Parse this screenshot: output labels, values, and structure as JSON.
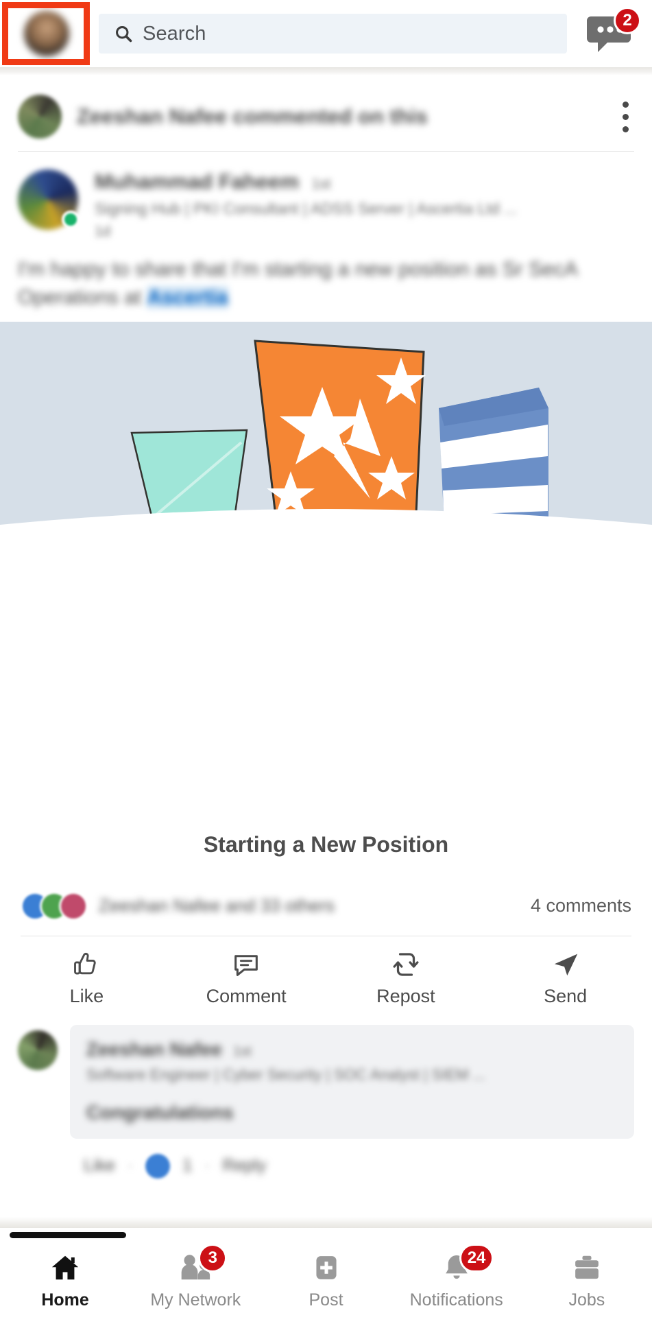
{
  "header": {
    "avatar_name": "profile-avatar",
    "search": {
      "placeholder": "Search",
      "icon": "search-icon"
    },
    "messaging": {
      "icon": "messaging-icon",
      "badge": "2"
    },
    "highlight_color": "#f03a15"
  },
  "post": {
    "context_text": "Zeeshan Nafee commented on this",
    "menu_icon": "more-options-icon",
    "author": {
      "name": "Muhammad Faheem",
      "degree": "1st",
      "headline": "Signing Hub | PKI Consultant | ADSS Server | Ascertia Ltd ...",
      "time": "1d"
    },
    "body_text": "I'm happy to share that I'm starting a new position as Sr SecA Operations at",
    "body_link": "Ascertia",
    "image_caption": "Starting a New Position",
    "reactions_text": "Zeeshan Nafee and 33 others",
    "comments_count": "4 comments",
    "actions": [
      {
        "label": "Like",
        "icon": "thumbs-up-icon"
      },
      {
        "label": "Comment",
        "icon": "comment-bubble-icon"
      },
      {
        "label": "Repost",
        "icon": "repost-icon"
      },
      {
        "label": "Send",
        "icon": "send-paper-plane-icon"
      }
    ]
  },
  "comment": {
    "author_name": "Zeeshan Nafee",
    "degree": "1st",
    "headline": "Software Engineer | Cyber Security | SOC Analyst | SIEM ...",
    "text": "Congratulations",
    "like_label": "Like",
    "reply_label": "Reply",
    "like_count": "1",
    "separator": "·"
  },
  "bottom_nav": [
    {
      "label": "Home",
      "icon": "home-icon",
      "badge": "",
      "active": true
    },
    {
      "label": "My Network",
      "icon": "my-network-icon",
      "badge": "3",
      "active": false
    },
    {
      "label": "Post",
      "icon": "post-plus-icon",
      "badge": "",
      "active": false
    },
    {
      "label": "Notifications",
      "icon": "bell-icon",
      "badge": "24",
      "active": false
    },
    {
      "label": "Jobs",
      "icon": "briefcase-icon",
      "badge": "",
      "active": false
    }
  ],
  "colors": {
    "badge_red": "#cc1016",
    "link_blue": "#0a66c2",
    "search_bg": "#eef3f8",
    "illustration_bg": "#d6dfe8",
    "banner_orange": "#f58634",
    "flag_teal": "#9fe6d8",
    "flag_blue": "#6b8fc7"
  }
}
